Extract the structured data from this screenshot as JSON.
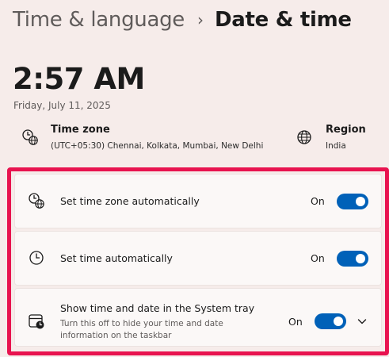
{
  "breadcrumb": {
    "parent": "Time & language",
    "separator": "›",
    "current": "Date & time"
  },
  "clock": {
    "time": "2:57 AM",
    "date": "Friday, July 11, 2025"
  },
  "timezone_info": {
    "title": "Time zone",
    "value": "(UTC+05:30) Chennai, Kolkata, Mumbai, New Delhi",
    "icon": "clock-globe-icon"
  },
  "region_info": {
    "title": "Region",
    "value": "India",
    "icon": "globe-icon"
  },
  "settings": [
    {
      "label": "Set time zone automatically",
      "state": "On",
      "icon": "clock-globe-icon"
    },
    {
      "label": "Set time automatically",
      "state": "On",
      "icon": "clock-icon"
    },
    {
      "label": "Show time and date in the System tray",
      "sublabel": "Turn this off to hide your time and date information on the taskbar",
      "state": "On",
      "icon": "calendar-clock-icon"
    }
  ],
  "colors": {
    "background": "#f6ecea",
    "accent": "#0061b8",
    "highlight_frame": "#e8134f"
  }
}
